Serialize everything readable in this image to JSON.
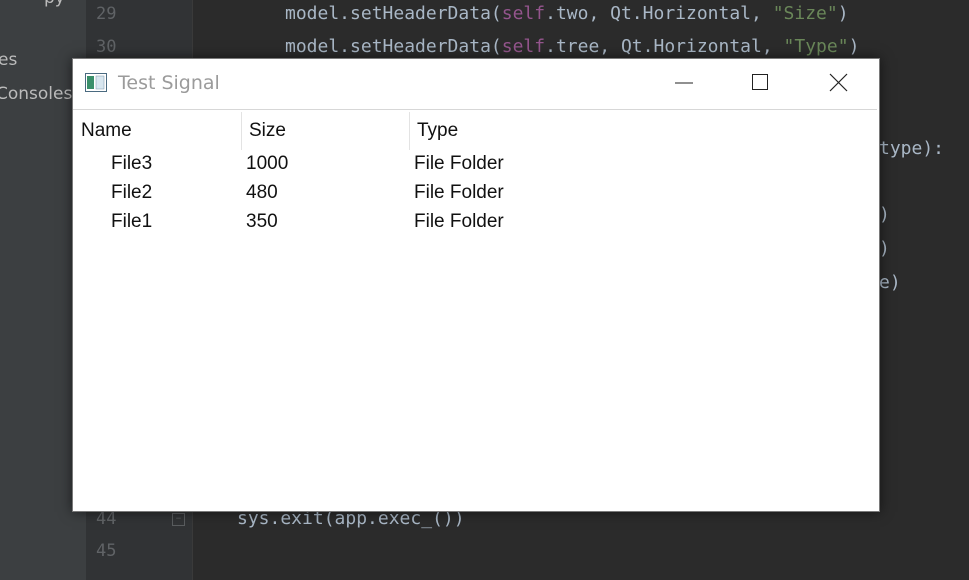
{
  "ide": {
    "project_items": [
      "py",
      "es",
      "Consoles"
    ],
    "line_numbers": {
      "top1": "29",
      "top2": "30",
      "bottom1": "44",
      "bottom2": "45"
    },
    "fold_symbol": "−",
    "line29": {
      "pre": "model.setHeaderData(",
      "self": "self",
      "mid": ".two, Qt.Horizontal, ",
      "str": "\"Size\"",
      "post": ")"
    },
    "line30": {
      "pre": "model.setHeaderData(",
      "self": "self",
      "mid": ".tree, Qt.Horizontal, ",
      "str": "\"Type\"",
      "post": ")"
    },
    "line44": "sys.exit(app.exec_())",
    "fragments": [
      "type):",
      ")",
      ")",
      "e)"
    ]
  },
  "window": {
    "title": "Test Signal",
    "icon": "qt-app-icon",
    "controls": [
      "minimize-icon",
      "maximize-icon",
      "close-icon"
    ]
  },
  "tree": {
    "columns": [
      "Name",
      "Size",
      "Type"
    ],
    "rows": [
      {
        "name": "File3",
        "size": "1000",
        "type": "File Folder"
      },
      {
        "name": "File2",
        "size": "480",
        "type": "File Folder"
      },
      {
        "name": "File1",
        "size": "350",
        "type": "File Folder"
      }
    ]
  },
  "colors": {
    "ide_bg": "#2b2b2b",
    "ide_panel": "#3c3f41",
    "keyword": "#94558d",
    "string": "#6a8759",
    "code_text": "#a9b7c6"
  }
}
